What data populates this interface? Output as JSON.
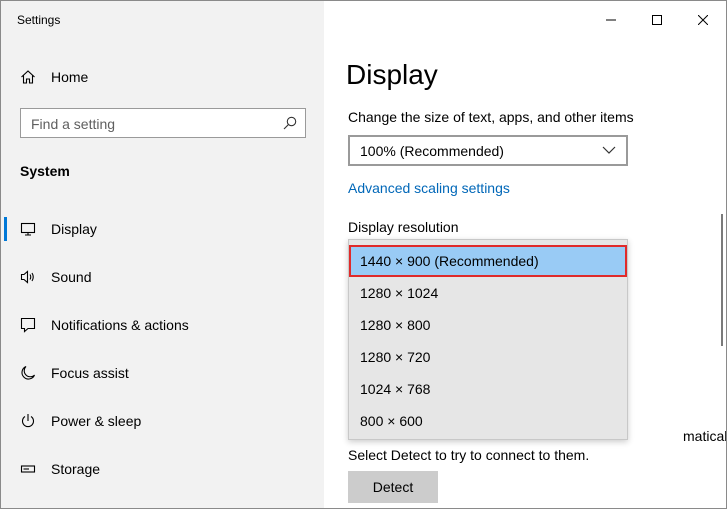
{
  "window": {
    "title": "Settings"
  },
  "sidebar": {
    "home_label": "Home",
    "search_placeholder": "Find a setting",
    "section_title": "System",
    "items": [
      {
        "label": "Display",
        "icon": "monitor-icon",
        "active": true
      },
      {
        "label": "Sound",
        "icon": "speaker-icon"
      },
      {
        "label": "Notifications & actions",
        "icon": "notification-icon"
      },
      {
        "label": "Focus assist",
        "icon": "moon-icon"
      },
      {
        "label": "Power & sleep",
        "icon": "power-icon"
      },
      {
        "label": "Storage",
        "icon": "storage-icon"
      }
    ]
  },
  "main": {
    "title": "Display",
    "scale_label": "Change the size of text, apps, and other items",
    "scale_value": "100% (Recommended)",
    "advanced_link": "Advanced scaling settings",
    "resolution_label": "Display resolution",
    "resolution_options": [
      "1440 × 900 (Recommended)",
      "1280 × 1024",
      "1280 × 800",
      "1280 × 720",
      "1024 × 768",
      "800 × 600"
    ],
    "selected_resolution_index": 0,
    "partial_text": "matically.",
    "detect_text": "Select Detect to try to connect to them.",
    "detect_button": "Detect"
  },
  "colors": {
    "accent": "#0078d7",
    "link": "#0067b8",
    "highlight": "#99cbf5",
    "highlight_border": "#e02a2a"
  }
}
